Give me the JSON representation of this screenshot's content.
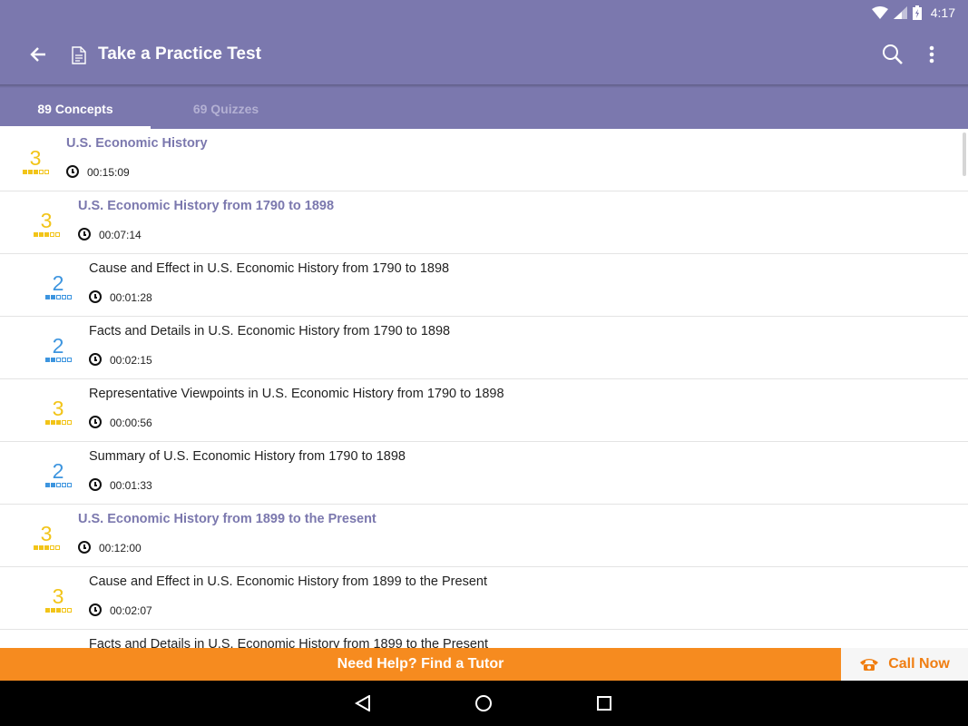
{
  "status_bar": {
    "time": "4:17"
  },
  "toolbar": {
    "title": "Take a Practice Test"
  },
  "tabs": [
    {
      "label": "89 Concepts",
      "active": true
    },
    {
      "label": "69 Quizzes",
      "active": false
    }
  ],
  "list": [
    {
      "title": "U.S. Economic History",
      "duration": "00:15:09",
      "level": "3",
      "level_filled": 3,
      "kind": "section"
    },
    {
      "title": "U.S. Economic History from 1790 to 1898",
      "duration": "00:07:14",
      "level": "3",
      "level_filled": 3,
      "kind": "section"
    },
    {
      "title": "Cause and Effect in U.S. Economic History from 1790 to 1898",
      "duration": "00:01:28",
      "level": "2",
      "level_filled": 2,
      "kind": "concept"
    },
    {
      "title": "Facts and Details in U.S. Economic History from 1790 to 1898",
      "duration": "00:02:15",
      "level": "2",
      "level_filled": 2,
      "kind": "concept"
    },
    {
      "title": "Representative Viewpoints in U.S. Economic History from 1790 to 1898",
      "duration": "00:00:56",
      "level": "3",
      "level_filled": 3,
      "kind": "concept"
    },
    {
      "title": "Summary of U.S. Economic History from 1790 to 1898",
      "duration": "00:01:33",
      "level": "2",
      "level_filled": 2,
      "kind": "concept"
    },
    {
      "title": "U.S. Economic History from 1899 to the Present",
      "duration": "00:12:00",
      "level": "3",
      "level_filled": 3,
      "kind": "section"
    },
    {
      "title": "Cause and Effect in U.S. Economic History from 1899 to the Present",
      "duration": "00:02:07",
      "level": "3",
      "level_filled": 3,
      "kind": "concept"
    },
    {
      "title": "Facts and Details in U.S. Economic History from 1899 to the Present",
      "duration": "",
      "level": "",
      "level_filled": 3,
      "kind": "concept"
    }
  ],
  "bottom": {
    "tutor_label": "Need Help? Find a Tutor",
    "call_label": "Call Now"
  },
  "colors": {
    "appbar": "#7b78ae",
    "section_title": "#7b78ae",
    "level_3": "#f2c418",
    "level_2": "#3d95df",
    "tutor_bar": "#f68b1f",
    "call_text": "#f07e12"
  },
  "icons": {
    "back": "back-arrow-icon",
    "doc": "document-icon",
    "search": "search-icon",
    "more": "more-vert-icon",
    "clock": "clock-icon",
    "phone": "phone-icon"
  }
}
